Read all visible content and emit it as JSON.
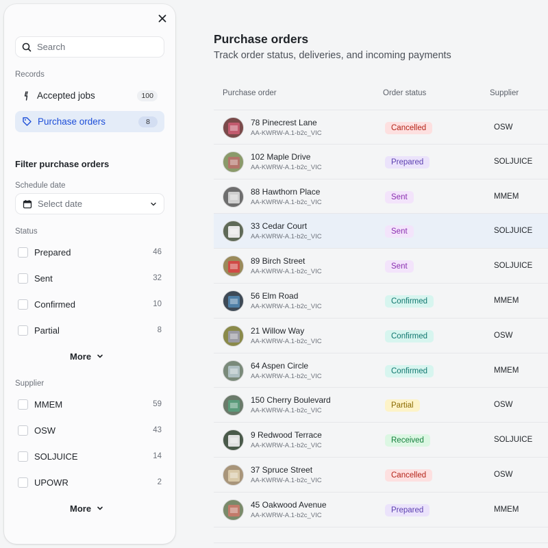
{
  "sidebar": {
    "search_placeholder": "Search",
    "records_label": "Records",
    "records": [
      {
        "label": "Accepted jobs",
        "count": "100",
        "icon": "bolt-icon",
        "active": false
      },
      {
        "label": "Purchase orders",
        "count": "8",
        "icon": "tag-icon",
        "active": true
      }
    ],
    "filter_title": "Filter purchase orders",
    "schedule_label": "Schedule date",
    "date_placeholder": "Select date",
    "status_label": "Status",
    "status_options": [
      {
        "label": "Prepared",
        "count": "46"
      },
      {
        "label": "Sent",
        "count": "32"
      },
      {
        "label": "Confirmed",
        "count": "10"
      },
      {
        "label": "Partial",
        "count": "8"
      }
    ],
    "status_more": "More",
    "supplier_label": "Supplier",
    "supplier_options": [
      {
        "label": "MMEM",
        "count": "59"
      },
      {
        "label": "OSW",
        "count": "43"
      },
      {
        "label": "SOLJUICE",
        "count": "14"
      },
      {
        "label": "UPOWR",
        "count": "2"
      }
    ],
    "supplier_more": "More"
  },
  "main": {
    "title": "Purchase orders",
    "subtitle": "Track order status, deliveries, and incoming payments",
    "columns": {
      "po": "Purchase order",
      "status": "Order status",
      "supplier": "Supplier"
    },
    "rows": [
      {
        "address": "78 Pinecrest Lane",
        "code": "AA-KWRW-A.1-b2c_VIC",
        "status": "Cancelled",
        "supplier": "OSW",
        "thumb": "#7a4a4a",
        "house": "#c25a6e"
      },
      {
        "address": "102 Maple Drive",
        "code": "AA-KWRW-A.1-b2c_VIC",
        "status": "Prepared",
        "supplier": "SOLJUICE",
        "thumb": "#8a9a6a",
        "house": "#b3746a"
      },
      {
        "address": "88 Hawthorn Place",
        "code": "AA-KWRW-A.1-b2c_VIC",
        "status": "Sent",
        "supplier": "MMEM",
        "thumb": "#6e6e6e",
        "house": "#cfcfcf"
      },
      {
        "address": "33 Cedar Court",
        "code": "AA-KWRW-A.1-b2c_VIC",
        "status": "Sent",
        "supplier": "SOLJUICE",
        "thumb": "#5f6a58",
        "house": "#e8e8e8"
      },
      {
        "address": "89 Birch Street",
        "code": "AA-KWRW-A.1-b2c_VIC",
        "status": "Sent",
        "supplier": "SOLJUICE",
        "thumb": "#9a8a5a",
        "house": "#d04a45"
      },
      {
        "address": "56 Elm Road",
        "code": "AA-KWRW-A.1-b2c_VIC",
        "status": "Confirmed",
        "supplier": "MMEM",
        "thumb": "#3e4a56",
        "house": "#4f7fa6"
      },
      {
        "address": "21 Willow Way",
        "code": "AA-KWRW-A.1-b2c_VIC",
        "status": "Confirmed",
        "supplier": "OSW",
        "thumb": "#8a8a4a",
        "house": "#9a9aa2"
      },
      {
        "address": "64 Aspen Circle",
        "code": "AA-KWRW-A.1-b2c_VIC",
        "status": "Confirmed",
        "supplier": "MMEM",
        "thumb": "#7a8a7a",
        "house": "#aebfc2"
      },
      {
        "address": "150 Cherry Boulevard",
        "code": "AA-KWRW-A.1-b2c_VIC",
        "status": "Partial",
        "supplier": "OSW",
        "thumb": "#6a7a6a",
        "house": "#5a9a7a"
      },
      {
        "address": "9 Redwood Terrace",
        "code": "AA-KWRW-A.1-b2c_VIC",
        "status": "Received",
        "supplier": "SOLJUICE",
        "thumb": "#4a5a4a",
        "house": "#e0e0e0"
      },
      {
        "address": "37 Spruce Street",
        "code": "AA-KWRW-A.1-b2c_VIC",
        "status": "Cancelled",
        "supplier": "OSW",
        "thumb": "#a8957a",
        "house": "#d8c8a8"
      },
      {
        "address": "45 Oakwood Avenue",
        "code": "AA-KWRW-A.1-b2c_VIC",
        "status": "Prepared",
        "supplier": "MMEM",
        "thumb": "#7a8a6a",
        "house": "#c27a6a"
      }
    ],
    "highlight_row": 3
  },
  "status_colors": {
    "Cancelled": {
      "bg": "#fde0e0",
      "fg": "#b42318"
    },
    "Prepared": {
      "bg": "#ebe3fb",
      "fg": "#5b3fb0"
    },
    "Sent": {
      "bg": "#f3e4fb",
      "fg": "#8a2fb0"
    },
    "Confirmed": {
      "bg": "#d7f5ef",
      "fg": "#0f766e"
    },
    "Partial": {
      "bg": "#fdf3c8",
      "fg": "#8a6a00"
    },
    "Received": {
      "bg": "#dcf7e3",
      "fg": "#15803d"
    }
  }
}
